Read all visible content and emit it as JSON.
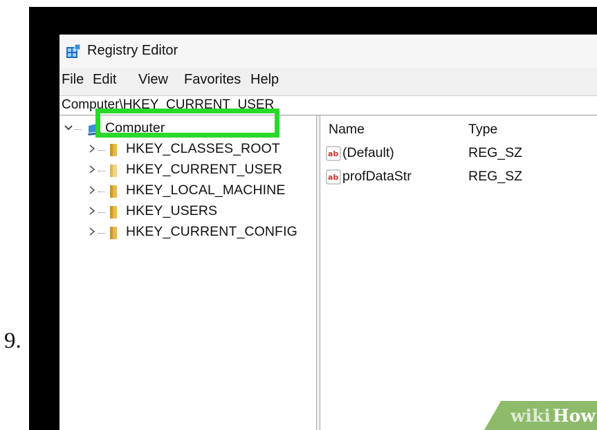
{
  "step": {
    "number": "9."
  },
  "window": {
    "title": "Registry Editor",
    "icon": "registry-editor-icon"
  },
  "menu": [
    "File",
    "Edit",
    "View",
    "Favorites",
    "Help"
  ],
  "address": "Computer\\HKEY_CURRENT_USER",
  "tree": {
    "root": {
      "label": "Computer",
      "icon": "computer-icon",
      "expanded": true
    },
    "keys": [
      {
        "label": "HKEY_CLASSES_ROOT",
        "icon": "folder-icon"
      },
      {
        "label": "HKEY_CURRENT_USER",
        "icon": "folder-icon",
        "selected": true
      },
      {
        "label": "HKEY_LOCAL_MACHINE",
        "icon": "folder-icon"
      },
      {
        "label": "HKEY_USERS",
        "icon": "folder-icon"
      },
      {
        "label": "HKEY_CURRENT_CONFIG",
        "icon": "folder-icon"
      }
    ]
  },
  "columns": {
    "name": "Name",
    "type": "Type"
  },
  "values": [
    {
      "name": "(Default)",
      "type": "REG_SZ",
      "icon": "string-value-icon"
    },
    {
      "name": "profDataStr",
      "type": "REG_SZ",
      "icon": "string-value-icon"
    }
  ],
  "annotation": {
    "highlight_color": "#2ad92a",
    "target": "HKEY_CURRENT_USER"
  },
  "watermark": {
    "part1": "wiki",
    "part2": "How"
  },
  "colors": {
    "folder": "#e8b94a",
    "computer": "#3a8fd8",
    "ab_icon": "#c0392b"
  }
}
